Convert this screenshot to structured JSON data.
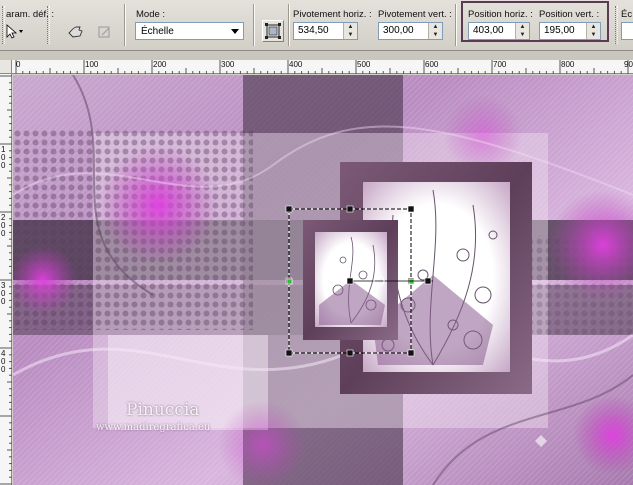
{
  "toolbar": {
    "presets_label": "aram. déf. :",
    "mode_label": "Mode :",
    "mode_value": "Échelle",
    "pivot_h_label": "Pivotement horiz. :",
    "pivot_h_value": "534,50",
    "pivot_v_label": "Pivotement vert. :",
    "pivot_v_value": "300,00",
    "pos_h_label": "Position horiz. :",
    "pos_h_value": "403,00",
    "pos_v_label": "Position vert. :",
    "pos_v_value": "195,00",
    "cut_label": "Éc"
  },
  "ruler": {
    "top_ticks": [
      "0",
      "100",
      "200",
      "300",
      "400",
      "500",
      "600",
      "700",
      "800",
      "900"
    ],
    "left_ticks": [
      "1\n0\n0",
      "2\n0\n0",
      "3\n0\n0",
      "4\n0\n0"
    ]
  },
  "canvas": {
    "watermark_name": "Pinuccia",
    "watermark_site": "www.madiregrafica.eu"
  },
  "colors": {
    "accent_purple": "#b23fb0",
    "frame_dark": "#6b4a66",
    "highlight_border": "#5b3a55"
  }
}
